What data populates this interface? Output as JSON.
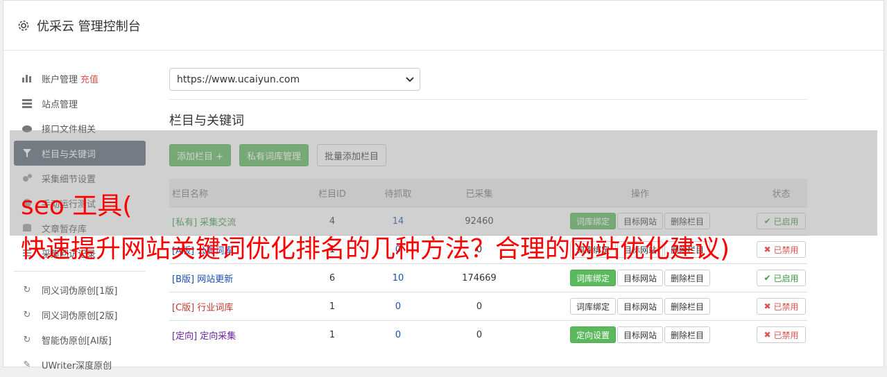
{
  "header": {
    "title": "优采云 管理控制台",
    "icon": "gear-icon"
  },
  "sidebar": {
    "items": [
      {
        "label": "账户管理",
        "extra": "充值",
        "icon": "bar-chart-icon"
      },
      {
        "label": "站点管理",
        "icon": "server-icon"
      },
      {
        "label": "接口文件相关",
        "icon": "cloud-upload-icon"
      },
      {
        "label": "栏目与关键词",
        "icon": "filter-icon",
        "active": true
      },
      {
        "label": "采集细节设置",
        "icon": "cogs-icon"
      },
      {
        "label": "手动运行测试",
        "icon": "play-icon"
      },
      {
        "label": "文章暂存库",
        "icon": "database-icon"
      },
      {
        "label": "采集回访记录",
        "icon": "list-icon"
      }
    ],
    "items2": [
      {
        "label": "同义词伪原创[1版]",
        "icon": "refresh-icon"
      },
      {
        "label": "同义词伪原创[2版]",
        "icon": "refresh-icon"
      },
      {
        "label": "智能伪原创[AI版]",
        "icon": "refresh-icon"
      },
      {
        "label": "UWriter深度原创",
        "icon": "edit-icon"
      }
    ]
  },
  "main": {
    "site_select": "https://www.ucaiyun.com",
    "section_title": "栏目与关键词",
    "buttons": {
      "add": "添加栏目 +",
      "private": "私有词库管理",
      "batch": "批量添加栏目"
    },
    "table": {
      "headers": [
        "栏目名称",
        "栏目ID",
        "待抓取",
        "已采集",
        "操作",
        "状态"
      ],
      "rows": [
        {
          "tag": "[私有]",
          "name": "采集交流",
          "id": "4",
          "pending": "14",
          "collected": "92460",
          "op1": "词库绑定",
          "op1_green": true,
          "op2": "目标网站",
          "op3": "删除栏目",
          "status": "已启用",
          "on": true
        },
        {
          "tag": "[A版]",
          "name": "公有词库",
          "id": "1",
          "pending": "0",
          "collected": "0",
          "op1": "词库绑定",
          "op1_green": false,
          "op2": "目标网站",
          "op3": "删除栏目",
          "status": "已禁用",
          "on": false
        },
        {
          "tag": "[B版]",
          "name": "网站更新",
          "id": "6",
          "pending": "10",
          "collected": "174669",
          "op1": "词库绑定",
          "op1_green": true,
          "op2": "目标网站",
          "op3": "删除栏目",
          "status": "已启用",
          "on": true
        },
        {
          "tag": "[C版]",
          "name": "行业词库",
          "id": "1",
          "pending": "0",
          "collected": "0",
          "op1": "词库绑定",
          "op1_green": false,
          "op2": "目标网站",
          "op3": "删除栏目",
          "status": "已禁用",
          "on": false
        },
        {
          "tag": "[定向]",
          "name": "定向采集",
          "id": "1",
          "pending": "0",
          "collected": "0",
          "op1": "定向设置",
          "op1_green": true,
          "op2": "目标网站",
          "op3": "删除栏目",
          "status": "已禁用",
          "on": false
        }
      ]
    }
  },
  "overlay": {
    "line1": "seo 工具(",
    "line2": "快速提升网站关键词优化排名的几种方法？合理的网站优化建议)"
  }
}
